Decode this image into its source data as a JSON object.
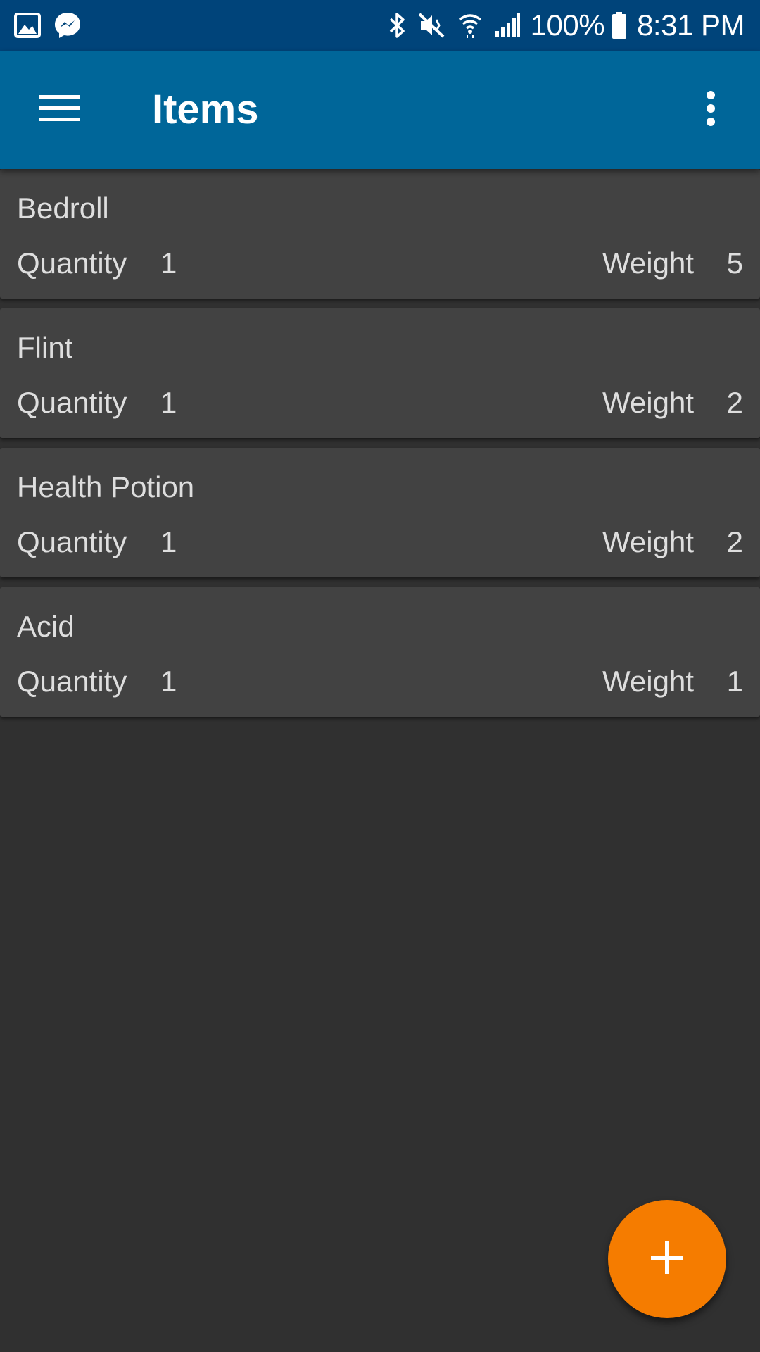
{
  "status_bar": {
    "left_icons": [
      "image-icon",
      "messenger-icon"
    ],
    "right_icons": [
      "bluetooth-icon",
      "mute-icon",
      "wifi-icon",
      "signal-icon",
      "battery-icon"
    ],
    "battery_text": "100%",
    "time": "8:31 PM"
  },
  "app_bar": {
    "title": "Items",
    "menu_icon": "hamburger-menu-icon",
    "overflow_icon": "more-vert-icon"
  },
  "items": [
    {
      "name": "Bedroll",
      "quantity_label": "Quantity",
      "quantity": "1",
      "weight_label": "Weight",
      "weight": "5"
    },
    {
      "name": "Flint",
      "quantity_label": "Quantity",
      "quantity": "1",
      "weight_label": "Weight",
      "weight": "2"
    },
    {
      "name": "Health Potion",
      "quantity_label": "Quantity",
      "quantity": "1",
      "weight_label": "Weight",
      "weight": "2"
    },
    {
      "name": "Acid",
      "quantity_label": "Quantity",
      "quantity": "1",
      "weight_label": "Weight",
      "weight": "1"
    }
  ],
  "fab": {
    "icon": "add-icon"
  },
  "colors": {
    "status_bar": "#00447a",
    "app_bar": "#006699",
    "background": "#303030",
    "card": "#424242",
    "card_text": "#dedede",
    "fab": "#f57c00"
  }
}
